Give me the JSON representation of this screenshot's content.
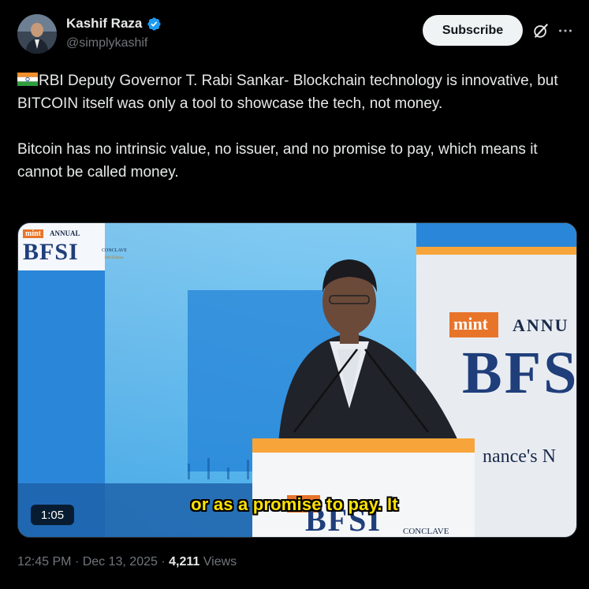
{
  "author": {
    "name": "Kashif Raza",
    "handle": "@simplykashif"
  },
  "actions": {
    "subscribe_label": "Subscribe"
  },
  "tweet": {
    "flag": "india-flag",
    "paragraph1": "RBI Deputy Governor T. Rabi Sankar- Blockchain technology is innovative, but BITCOIN itself was only a tool to showcase the tech, not money.",
    "paragraph2": "Bitcoin has no intrinsic value, no issuer, and no promise to pay, which means it cannot be called money."
  },
  "video": {
    "caption": "or as a promise to pay. It",
    "duration": "1:05",
    "left_banner": {
      "brand": "mint",
      "annual": "ANNUAL",
      "title": "BFSI",
      "conclave": "CONCLAVE",
      "edition": "18th Edition"
    },
    "right_banner": {
      "brand": "mint",
      "annual": "ANNU",
      "title": "BFS",
      "tagline": "nance's N"
    },
    "podium": {
      "title": "BFSI",
      "conclave": "CONCLAVE"
    }
  },
  "meta": {
    "time": "12:45 PM",
    "date": "Dec 13, 2025",
    "views_count": "4,211",
    "views_label": "Views",
    "separator": "·"
  },
  "colors": {
    "accent_verified": "#1d9bf0",
    "caption": "#ffe100",
    "mint_orange": "#f47b20"
  }
}
